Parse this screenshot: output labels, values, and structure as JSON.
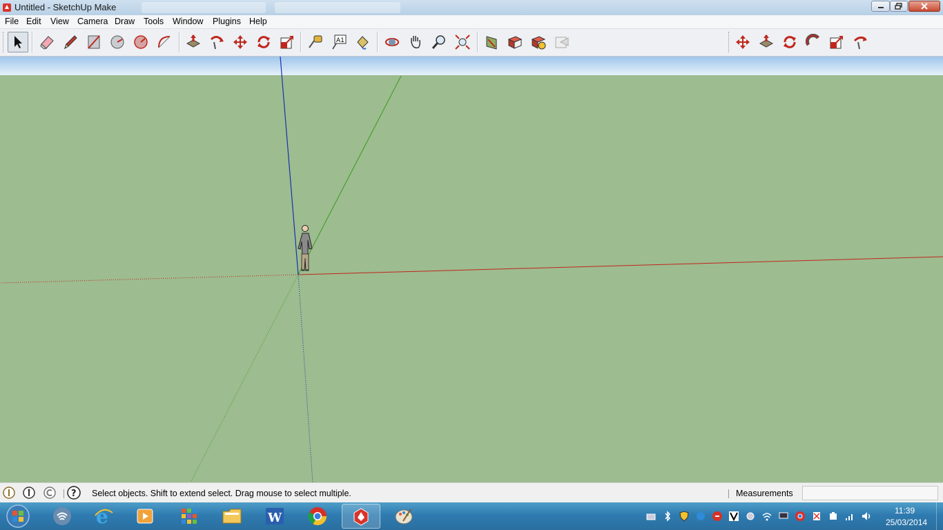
{
  "window": {
    "title": "Untitled - SketchUp Make"
  },
  "menu": {
    "items": [
      {
        "label": "File"
      },
      {
        "label": "Edit"
      },
      {
        "label": "View"
      },
      {
        "label": "Camera"
      },
      {
        "label": "Draw"
      },
      {
        "label": "Tools"
      },
      {
        "label": "Window"
      },
      {
        "label": "Plugins"
      },
      {
        "label": "Help"
      }
    ]
  },
  "toolbar": {
    "tools": [
      "select",
      "eraser",
      "pencil",
      "rectangle",
      "circle",
      "polygon",
      "arc",
      "push-pull",
      "follow-me",
      "move",
      "rotate",
      "scale",
      "tape-measure",
      "text",
      "paint-bucket",
      "orbit",
      "pan",
      "zoom",
      "zoom-extents",
      "section",
      "get-models",
      "share-model",
      "share-component",
      "layout"
    ],
    "extra_tools": [
      "move",
      "push-pull",
      "rotate",
      "follow-me",
      "scale",
      "offset"
    ]
  },
  "status": {
    "hint": "Select objects. Shift to extend select. Drag mouse to select multiple.",
    "measurements_label": "Measurements",
    "measurements_value": ""
  },
  "colors": {
    "ground": "#9dbc8f",
    "sky": "#b9d8f2",
    "axis_red": "#c0261c",
    "axis_green": "#3a9a22",
    "axis_blue": "#1a2fb0"
  },
  "taskbar": {
    "apps": [
      "internet-explorer",
      "media-player",
      "metro-apps",
      "file-explorer",
      "word",
      "chrome",
      "sketchup",
      "paint"
    ],
    "active_app": "sketchup",
    "clock": {
      "time": "11:39",
      "date": "25/03/2014"
    }
  }
}
